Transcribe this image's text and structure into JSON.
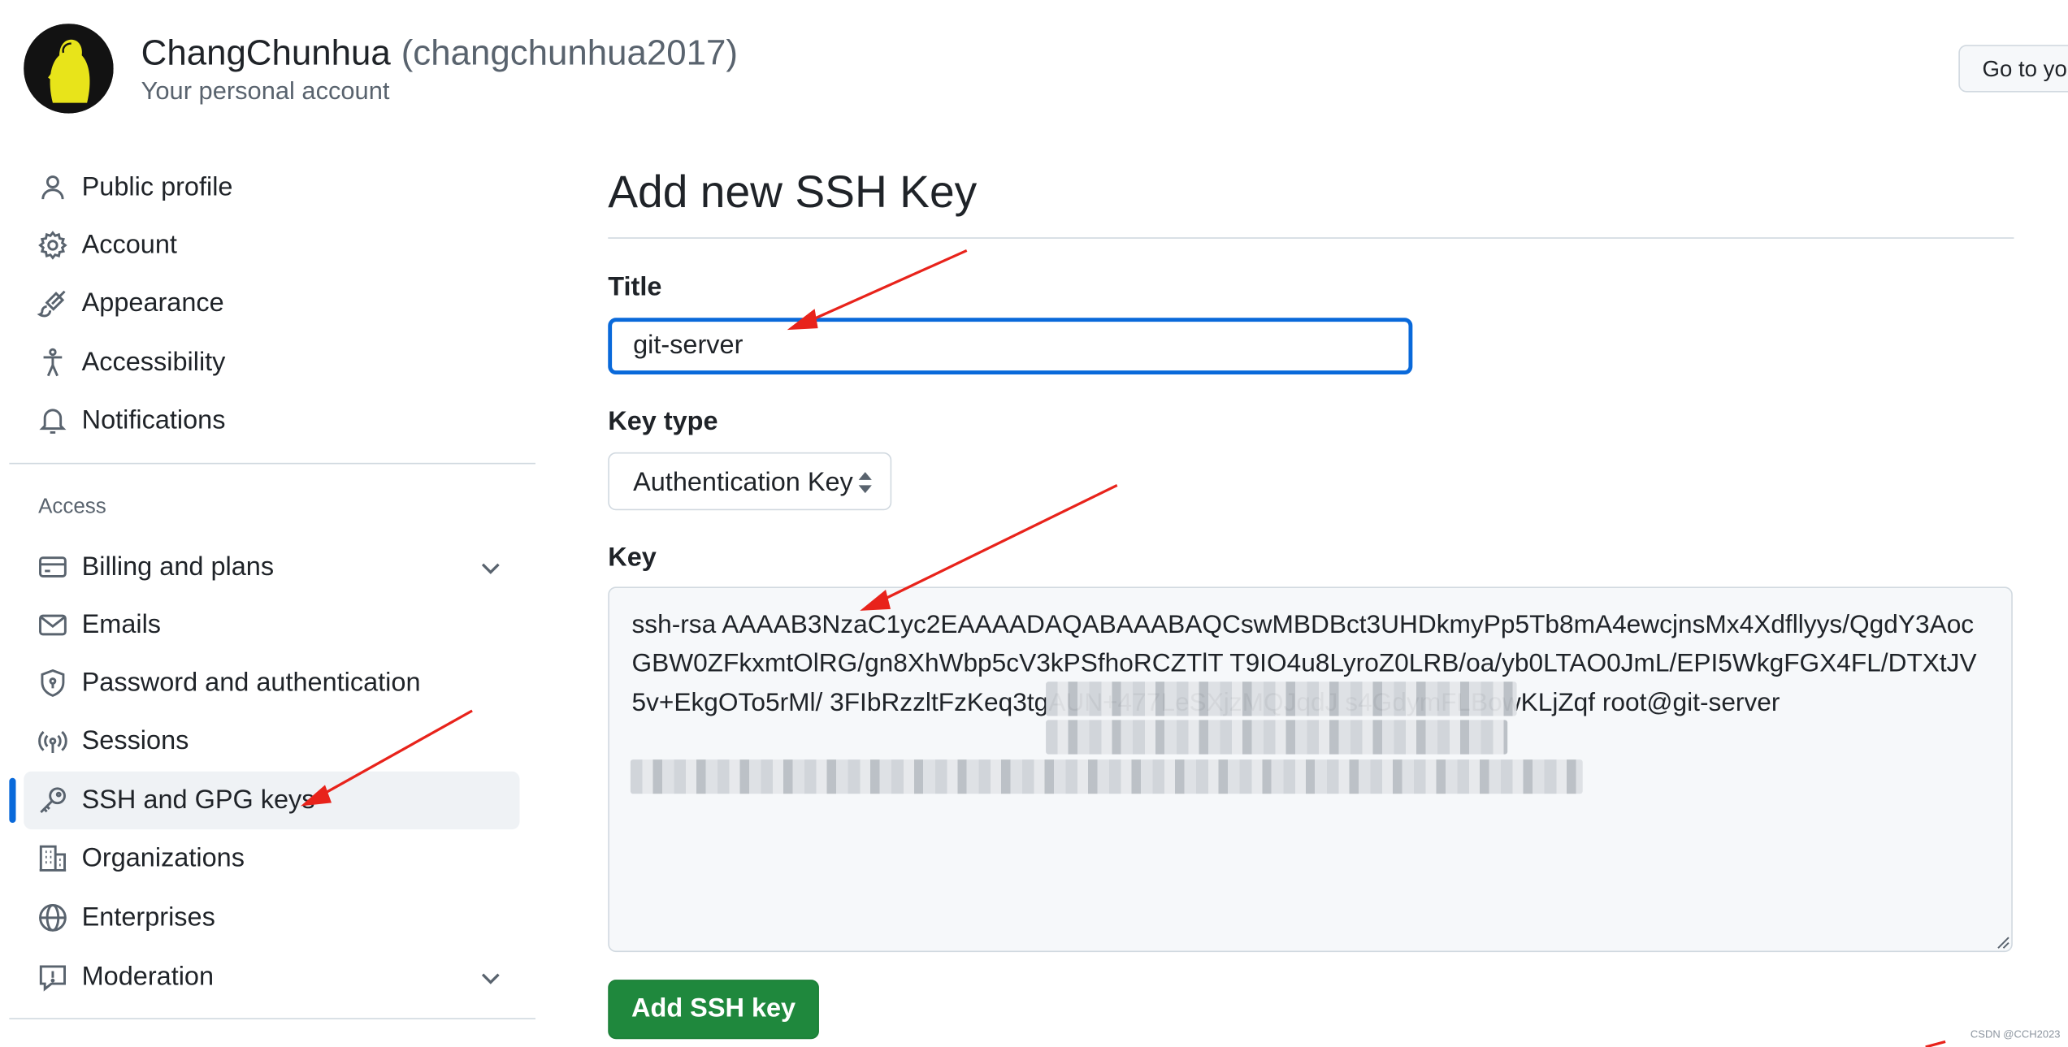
{
  "header": {
    "display_name": "ChangChunhua",
    "login": "(changchunhua2017)",
    "subtitle": "Your personal account",
    "go_to_profile_label": "Go to yo"
  },
  "sidebar": {
    "items": [
      {
        "label": "Public profile",
        "icon": "person-icon"
      },
      {
        "label": "Account",
        "icon": "gear-icon"
      },
      {
        "label": "Appearance",
        "icon": "paintbrush-icon"
      },
      {
        "label": "Accessibility",
        "icon": "accessibility-icon"
      },
      {
        "label": "Notifications",
        "icon": "bell-icon"
      }
    ],
    "access_heading": "Access",
    "access_items": [
      {
        "label": "Billing and plans",
        "icon": "credit-card-icon",
        "expandable": true
      },
      {
        "label": "Emails",
        "icon": "mail-icon"
      },
      {
        "label": "Password and authentication",
        "icon": "shield-lock-icon"
      },
      {
        "label": "Sessions",
        "icon": "broadcast-icon"
      },
      {
        "label": "SSH and GPG keys",
        "icon": "key-icon",
        "active": true
      },
      {
        "label": "Organizations",
        "icon": "organization-icon"
      },
      {
        "label": "Enterprises",
        "icon": "globe-icon"
      },
      {
        "label": "Moderation",
        "icon": "report-icon",
        "expandable": true
      }
    ]
  },
  "form": {
    "heading": "Add new SSH Key",
    "title_label": "Title",
    "title_value": "git-server",
    "key_type_label": "Key type",
    "key_type_value": "Authentication Key",
    "key_label": "Key",
    "key_value": "ssh-rsa AAAAB3NzaC1yc2EAAAADAQABAAABAQCswMBDBct3UHDkmyPp5Tb8mA4ewcjnsMx4Xdfllyys/QgdY3AocGBW0ZFkxmtOlRG/gn8XhWbp5cV3kPSfhoRCZTlT T9IO4u8LyroZ0LRB/oa/yb0LTAO0JmL/EPI5WkgFGX4FL/DTXtJV5v+EkgOTo5rMl/ 3FIbRzzltFzKeq3tgAUN+477LeSXjzMQJqdJ s4GdymFLBowKLjZqf root@git-server",
    "submit_label": "Add SSH key"
  },
  "watermark": "CSDN @CCH2023",
  "colors": {
    "primary_button": "#1f883d",
    "focus_border": "#0969da",
    "active_indicator": "#0969da",
    "annotation_arrow": "#e8231b"
  }
}
